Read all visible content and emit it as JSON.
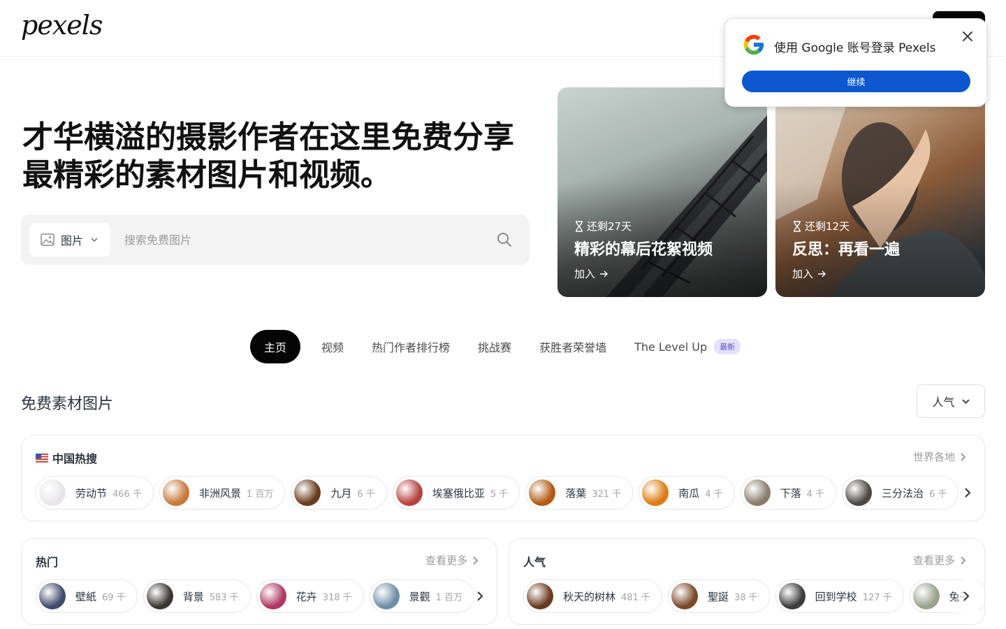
{
  "header": {
    "logo": "pexels"
  },
  "hero": {
    "title": "才华横溢的摄影作者在这里免费分享最精彩的素材图片和视频。",
    "search": {
      "type_label": "图片",
      "placeholder": "搜索免费图片"
    }
  },
  "challenges": [
    {
      "remaining": "还剩27天",
      "title": "精彩的幕后花絮视频",
      "join": "加入"
    },
    {
      "remaining": "还剩12天",
      "title": "反思：再看一遍",
      "join": "加入"
    }
  ],
  "google_popup": {
    "text": "使用 Google 账号登录 Pexels",
    "continue": "继续"
  },
  "tabs": [
    {
      "label": "主页"
    },
    {
      "label": "视频"
    },
    {
      "label": "热门作者排行榜"
    },
    {
      "label": "挑战赛"
    },
    {
      "label": "获胜者荣誉墙"
    },
    {
      "label": "The Level Up",
      "badge": "最新"
    }
  ],
  "section": {
    "title": "免费素材图片",
    "sort": "人气"
  },
  "china_panel": {
    "title": "中国热搜",
    "more": "世界各地",
    "chips": [
      {
        "name": "劳动节",
        "count": "466 千",
        "color": "#e9e6ea"
      },
      {
        "name": "非洲风景",
        "count": "1 百万",
        "color": "#c9793b"
      },
      {
        "name": "九月",
        "count": "6 千",
        "color": "#6b3a1c"
      },
      {
        "name": "埃塞俄比亚",
        "count": "5 千",
        "color": "#b8423e"
      },
      {
        "name": "落葉",
        "count": "321 千",
        "color": "#b35a12"
      },
      {
        "name": "南瓜",
        "count": "4 千",
        "color": "#e07b12"
      },
      {
        "name": "下落",
        "count": "4 千",
        "color": "#8a7d6c"
      },
      {
        "name": "三分法治",
        "count": "6 千",
        "color": "#4d4a45"
      }
    ]
  },
  "hot_panel": {
    "title": "热门",
    "more": "查看更多",
    "chips": [
      {
        "name": "壁紙",
        "count": "69 千",
        "color": "#3f4c6e"
      },
      {
        "name": "背景",
        "count": "583 千",
        "color": "#3a3532"
      },
      {
        "name": "花卉",
        "count": "318 千",
        "color": "#b23762"
      },
      {
        "name": "景觀",
        "count": "1 百万",
        "color": "#6f8fa6"
      }
    ]
  },
  "popular_panel": {
    "title": "人气",
    "more": "查看更多",
    "chips": [
      {
        "name": "秋天的树林",
        "count": "481 千",
        "color": "#6a3a1e"
      },
      {
        "name": "聖誕",
        "count": "38 千",
        "color": "#7a4a2a"
      },
      {
        "name": "回到学校",
        "count": "127 千",
        "color": "#3c3c3c"
      },
      {
        "name": "兔子",
        "count": "",
        "color": "#9aa38b"
      }
    ]
  }
}
